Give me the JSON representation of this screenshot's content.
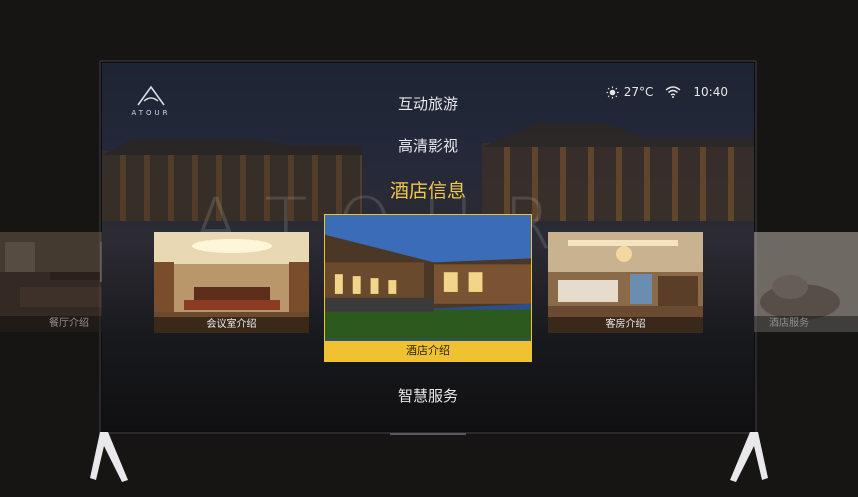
{
  "brand": {
    "logo_text": "ATOUR",
    "watermark": "ATOUR"
  },
  "status_bar": {
    "weather_icon": "sun-icon",
    "temperature": "27°C",
    "wifi_icon": "wifi-icon",
    "time": "10:40"
  },
  "menu": {
    "items": [
      {
        "label": "互动旅游"
      },
      {
        "label": "高清影视"
      },
      {
        "label": "酒店信息",
        "active": true
      },
      {
        "label": "智慧服务"
      }
    ]
  },
  "carousel": {
    "cards": [
      {
        "label": "餐厅介绍"
      },
      {
        "label": "会议室介绍"
      },
      {
        "label": "酒店介绍",
        "selected": true
      },
      {
        "label": "客房介绍"
      },
      {
        "label": "酒店服务"
      }
    ]
  },
  "colors": {
    "accent": "#f0c231",
    "active_menu": "#f1c84a",
    "frame": "#0d0d0f"
  }
}
